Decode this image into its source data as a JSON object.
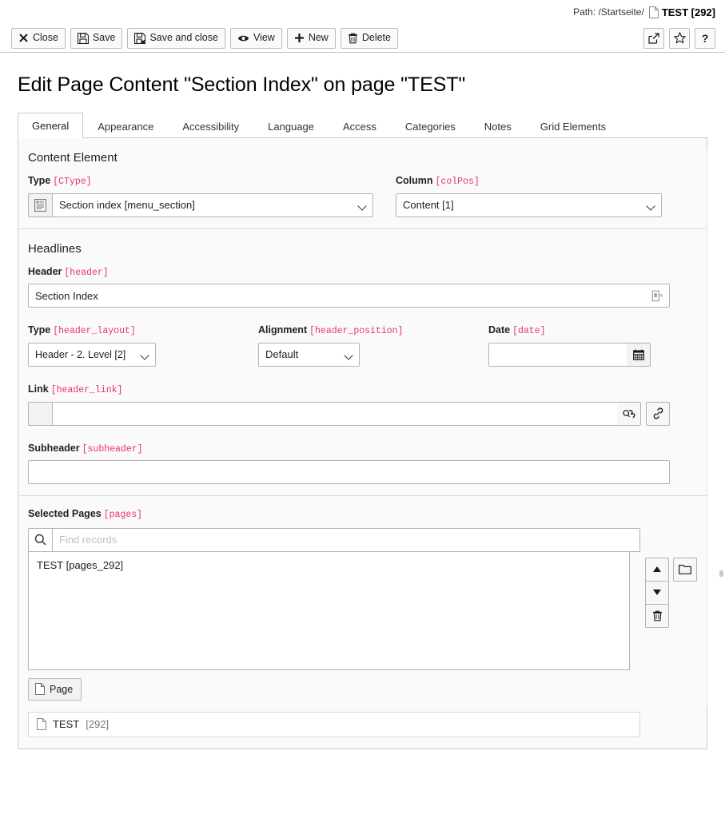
{
  "docheader": {
    "path_label": "Path: /Startseite/",
    "path_title": "TEST [292]",
    "buttons": [
      {
        "id": "close",
        "label": "Close",
        "icon": "close-icon"
      },
      {
        "id": "save",
        "label": "Save",
        "icon": "save-icon"
      },
      {
        "id": "save-and-close",
        "label": "Save and close",
        "icon": "save-and-close-icon"
      },
      {
        "id": "view",
        "label": "View",
        "icon": "eye-icon"
      },
      {
        "id": "new",
        "label": "New",
        "icon": "plus-icon"
      },
      {
        "id": "delete",
        "label": "Delete",
        "icon": "trash-icon"
      }
    ],
    "right_buttons": [
      {
        "id": "open-in-new-window",
        "label": "",
        "icon": "open-in-new-window-icon"
      },
      {
        "id": "bookmark",
        "label": "",
        "icon": "star-icon"
      },
      {
        "id": "help",
        "label": "?",
        "icon": "help-icon"
      }
    ]
  },
  "page_title": "Edit Page Content \"Section Index\" on page \"TEST\"",
  "tabs": [
    {
      "label": "General",
      "active": true
    },
    {
      "label": "Appearance",
      "active": false
    },
    {
      "label": "Accessibility",
      "active": false
    },
    {
      "label": "Language",
      "active": false
    },
    {
      "label": "Access",
      "active": false
    },
    {
      "label": "Categories",
      "active": false
    },
    {
      "label": "Notes",
      "active": false
    },
    {
      "label": "Grid Elements",
      "active": false
    }
  ],
  "content_element": {
    "legend": "Content Element",
    "type": {
      "label": "Type",
      "key": "[CType]",
      "value": "Section index [menu_section]",
      "options": [
        "Section index [menu_section]"
      ],
      "icon": "section-index-icon"
    },
    "column": {
      "label": "Column",
      "key": "[colPos]",
      "value": "Content [1]",
      "options": [
        "Content [1]"
      ]
    }
  },
  "headlines": {
    "legend": "Headlines",
    "header": {
      "label": "Header",
      "key": "[header]",
      "value": "Section Index",
      "placeholder": "",
      "trailing_icon": "field-control-icon"
    },
    "header_layout": {
      "label": "Type",
      "key": "[header_layout]",
      "value": "Header - 2. Level [2]",
      "options": [
        "Header - 2. Level [2]"
      ]
    },
    "header_position": {
      "label": "Alignment",
      "key": "[header_position]",
      "value": "Default",
      "options": [
        "Default"
      ]
    },
    "date": {
      "label": "Date",
      "key": "[date]",
      "value": "",
      "placeholder": "",
      "icon": "calendar-icon"
    },
    "header_link": {
      "label": "Link",
      "key": "[header_link]",
      "value": "",
      "placeholder": "",
      "browse_icon": "link-browser-icon",
      "link_icon": "chain-link-icon"
    },
    "subheader": {
      "label": "Subheader",
      "key": "[subheader]",
      "value": "",
      "placeholder": ""
    }
  },
  "selected_pages": {
    "label": "Selected Pages",
    "key": "[pages]",
    "search_placeholder": "Find records",
    "search_value": "",
    "search_icon": "search-icon",
    "items": [
      "TEST [pages_292]"
    ],
    "controls": [
      {
        "id": "move-up",
        "icon": "arrow-up-icon"
      },
      {
        "id": "move-down",
        "icon": "arrow-down-icon"
      },
      {
        "id": "remove",
        "icon": "trash-icon"
      }
    ],
    "browse_button": {
      "id": "browse-pages",
      "icon": "folder-icon"
    },
    "element_browser_button": {
      "label": "Page",
      "icon": "page-icon"
    },
    "record": {
      "title": "TEST",
      "id": "[292]",
      "icon": "page-icon"
    }
  }
}
